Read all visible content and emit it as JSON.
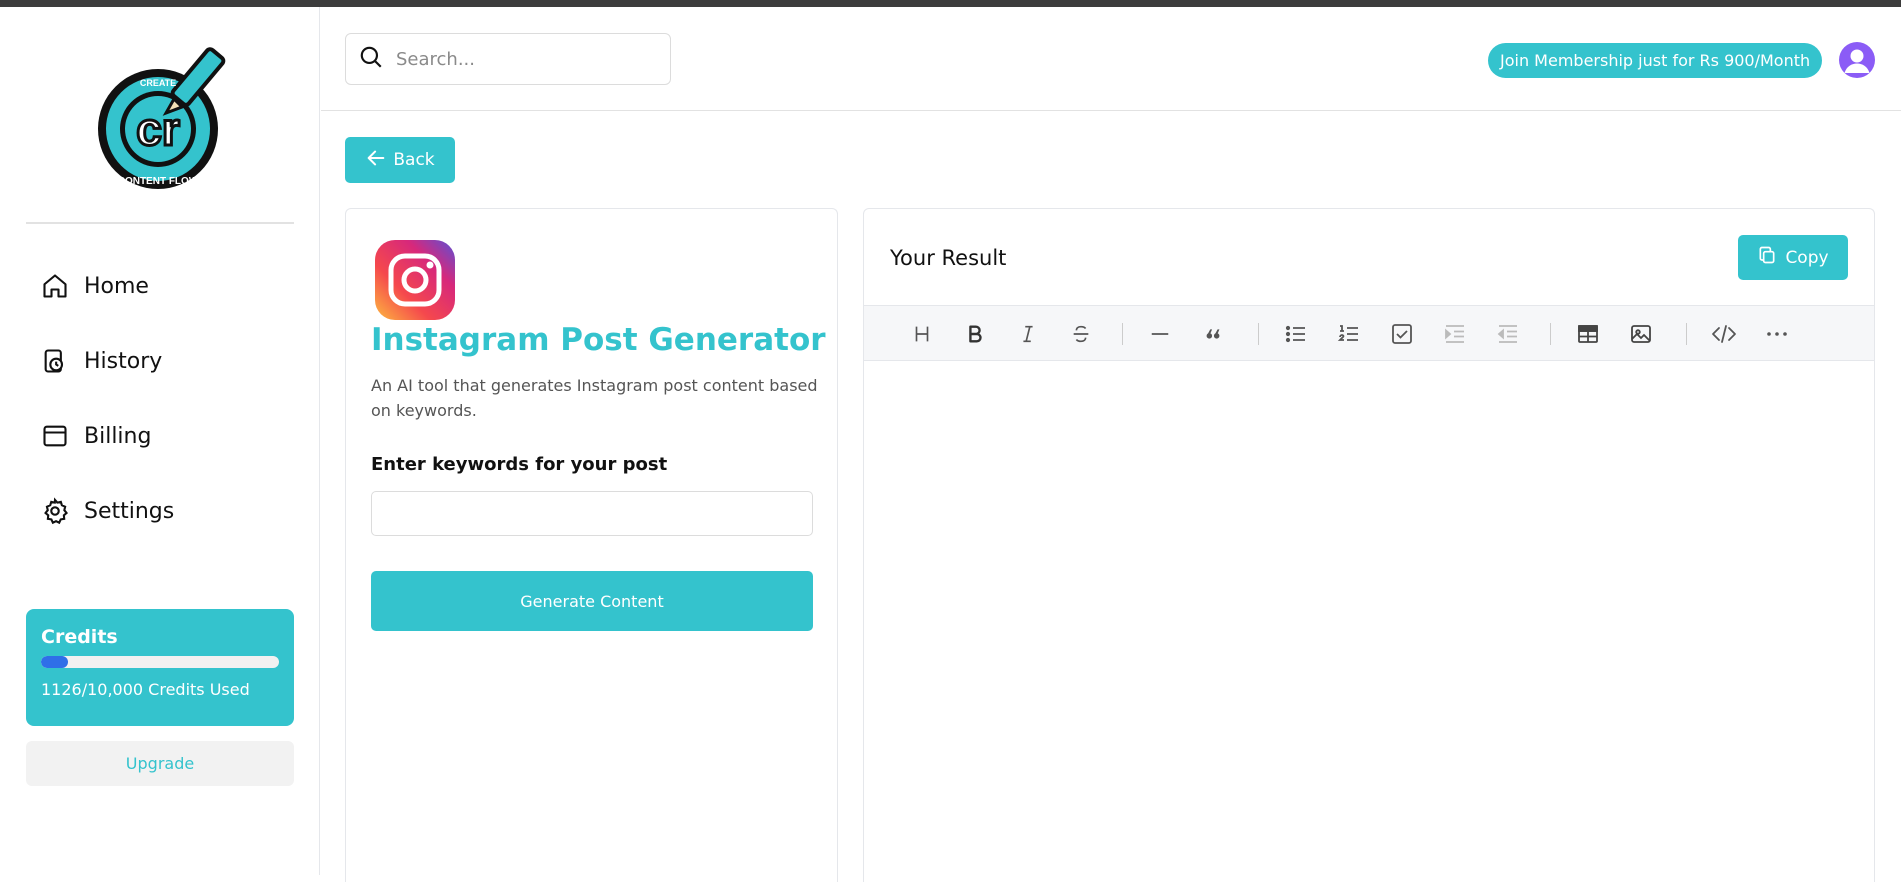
{
  "app": {
    "brand_top": "CREATE",
    "brand_mark": "cr",
    "brand_bottom": "CONTENT FLOW"
  },
  "sidebar": {
    "items": [
      {
        "label": "Home",
        "icon": "home-icon"
      },
      {
        "label": "History",
        "icon": "history-icon"
      },
      {
        "label": "Billing",
        "icon": "billing-icon"
      },
      {
        "label": "Settings",
        "icon": "gear-icon"
      }
    ],
    "credits": {
      "title": "Credits",
      "used_text": "1126/10,000 Credits Used",
      "used": 1126,
      "total": 10000
    },
    "upgrade_label": "Upgrade"
  },
  "header": {
    "search_placeholder": "Search...",
    "membership_label": "Join Membership just for Rs 900/Month"
  },
  "main": {
    "back_label": "Back",
    "tool": {
      "title": "Instagram Post Generator",
      "description": "An AI tool that generates Instagram post content based on keywords.",
      "field_label": "Enter keywords for your post",
      "field_value": "",
      "generate_label": "Generate Content"
    },
    "result": {
      "title": "Your Result",
      "copy_label": "Copy"
    },
    "toolbar": [
      "heading",
      "bold",
      "italic",
      "strikethrough",
      "horizontal-rule",
      "quote",
      "bullet-list",
      "ordered-list",
      "task-list",
      "indent",
      "outdent",
      "table",
      "image",
      "code",
      "more"
    ]
  },
  "colors": {
    "accent": "#34c3cd",
    "progress": "#2f6fe8",
    "avatar": "#8b5cf6"
  }
}
